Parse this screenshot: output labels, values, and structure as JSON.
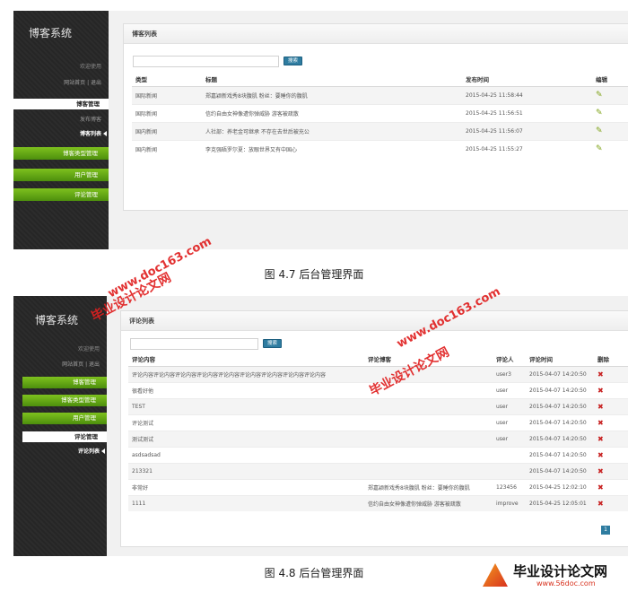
{
  "screen1": {
    "brand": "博客系统",
    "welcome": "欢迎使用",
    "links": "网站首页 | 退出",
    "menu": {
      "blog_manage": "博客管理",
      "publish_blog": "发布博客",
      "blog_list": "博客列表",
      "type_manage": "博客类型管理",
      "user_manage": "用户管理",
      "comment_manage": "评论管理"
    },
    "panel_title": "博客列表",
    "search_button": "搜索",
    "columns": [
      "类型",
      "标题",
      "发布时间",
      "编辑"
    ],
    "rows": [
      {
        "type": "国际新闻",
        "title": "郑嘉颖新戏秀8块腹肌 粉丝：要睡你的腹肌",
        "time": "2015-04-25 11:58:44"
      },
      {
        "type": "国际新闻",
        "title": "信约自由女神像遭你弹威胁 游客被疏散",
        "time": "2015-04-25 11:56:51"
      },
      {
        "type": "国内新闻",
        "title": "人社部：养老金可继承 不存在去世后被充公",
        "time": "2015-04-25 11:56:07"
      },
      {
        "type": "国内新闻",
        "title": "李克强晤罗尔夏：放眼世界又有中国心",
        "time": "2015-04-25 11:55:27"
      }
    ]
  },
  "caption1": "图 4.7  后台管理界面",
  "screen2": {
    "brand": "博客系统",
    "welcome": "欢迎使用",
    "links": "网站首页 | 退出",
    "menu": {
      "blog_manage": "博客管理",
      "type_manage": "博客类型管理",
      "user_manage": "用户管理",
      "comment_manage": "评论管理",
      "comment_list": "评论列表"
    },
    "panel_title": "评论列表",
    "search_button": "搜索",
    "columns": [
      "评论内容",
      "评论博客",
      "评论人",
      "评论时间",
      "删除"
    ],
    "rows": [
      {
        "content": "评论内容评论内容评论内容评论内容评论内容评论内容评论内容评论内容评论内容",
        "blog": "",
        "user": "user3",
        "time": "2015-04-07 14:20:50"
      },
      {
        "content": "很看好他",
        "blog": "",
        "user": "user",
        "time": "2015-04-07 14:20:50"
      },
      {
        "content": "TEST",
        "blog": "",
        "user": "user",
        "time": "2015-04-07 14:20:50"
      },
      {
        "content": "评论测试",
        "blog": "",
        "user": "user",
        "time": "2015-04-07 14:20:50"
      },
      {
        "content": "测试测试",
        "blog": "",
        "user": "user",
        "time": "2015-04-07 14:20:50"
      },
      {
        "content": "asdsadsad",
        "blog": "",
        "user": "",
        "time": "2015-04-07 14:20:50"
      },
      {
        "content": "213321",
        "blog": "",
        "user": "",
        "time": "2015-04-07 14:20:50"
      },
      {
        "content": "非常好",
        "blog": "郑嘉颖新戏秀8块腹肌 粉丝：要睡你的腹肌",
        "user": "123456",
        "time": "2015-04-25 12:02:10"
      },
      {
        "content": "1111",
        "blog": "信约自由女神像遭你弹威胁 游客被疏散",
        "user": "improve",
        "time": "2015-04-25 12:05:01"
      }
    ],
    "page": "1"
  },
  "caption2": "图 4.8  后台管理界面",
  "watermarks": {
    "url": "www.doc163.com",
    "site": "毕业设计论文网"
  },
  "logo": {
    "text": "毕业设计论文网",
    "url": "www.56doc.com"
  },
  "icons": {
    "edit": "pencil-icon",
    "delete": "delete-x-icon"
  }
}
